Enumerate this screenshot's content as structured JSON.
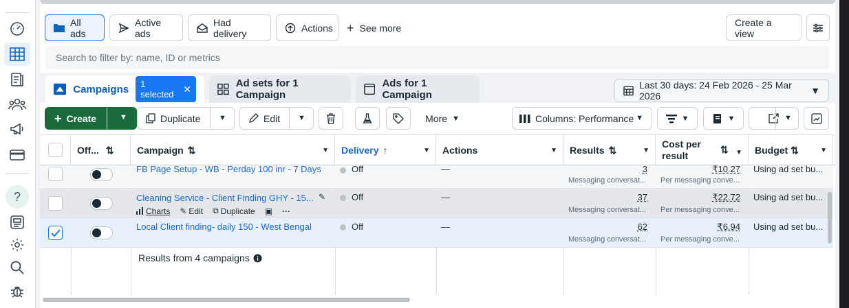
{
  "filters": {
    "all_ads": "All ads",
    "active_ads": "Active ads",
    "had_delivery": "Had delivery",
    "actions": "Actions",
    "see_more": "See more",
    "create_view": "Create a view"
  },
  "search": {
    "placeholder": "Search to filter by: name, ID or metrics"
  },
  "tabs": {
    "campaigns": "Campaigns",
    "selected_badge": "1 selected",
    "ad_sets": "Ad sets for 1 Campaign",
    "ads": "Ads for 1 Campaign"
  },
  "date_range": "Last 30 days: 24 Feb 2026 - 25 Mar 2026",
  "toolbar": {
    "create": "Create",
    "duplicate": "Duplicate",
    "edit": "Edit",
    "more": "More",
    "columns": "Columns: Performance"
  },
  "columns": {
    "off_on": "Off...",
    "campaign": "Campaign",
    "delivery": "Delivery",
    "actions": "Actions",
    "results": "Results",
    "cost_per_result_1": "Cost per",
    "cost_per_result_2": "result",
    "budget": "Budget"
  },
  "rows": [
    {
      "campaign": "FB Page Setup - WB - Perday 100 inr - 7 Days",
      "delivery": "Off",
      "actions": "—",
      "results": "3",
      "results_sub": "Messaging conversat...",
      "cost": "₹10.27",
      "cost_sub": "Per messaging conve...",
      "budget": "",
      "checked": false
    },
    {
      "campaign": "Cleaning Service - Client Finding GHY - 15...",
      "delivery": "Off",
      "actions": "—",
      "results": "37",
      "results_sub": "Messaging conversat...",
      "cost": "₹22.72",
      "cost_sub": "Per messaging conve...",
      "budget": "Using ad set bu...",
      "checked": false
    },
    {
      "campaign": "Local Client finding- daily 150 - West Bengal",
      "delivery": "Off",
      "actions": "—",
      "results": "62",
      "results_sub": "Messaging conversat...",
      "cost": "₹6.94",
      "cost_sub": "Per messaging conve...",
      "budget": "Using ad set bu...",
      "checked": true
    }
  ],
  "row_hover_actions": {
    "charts": "Charts",
    "edit": "Edit",
    "duplicate": "Duplicate"
  },
  "row1_budget": "Using ad set bu...",
  "footer": {
    "results_from": "Results from 4 campaigns"
  }
}
